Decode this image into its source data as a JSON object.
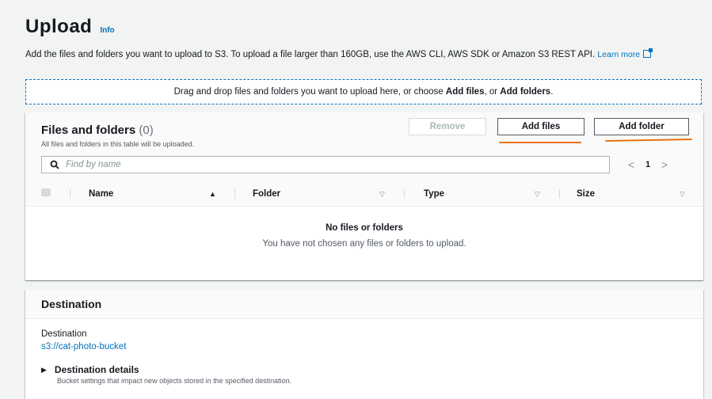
{
  "header": {
    "title": "Upload",
    "info": "Info"
  },
  "description": {
    "text": "Add the files and folders you want to upload to S3. To upload a file larger than 160GB, use the AWS CLI, AWS SDK or Amazon S3 REST API.",
    "learn_more": "Learn more"
  },
  "dropzone": {
    "prefix": "Drag and drop files and folders you want to upload here, or choose",
    "add_files": "Add files",
    "or": ", or",
    "add_folders": "Add folders",
    "suffix": "."
  },
  "files_panel": {
    "title": "Files and folders",
    "count": "(0)",
    "subtitle": "All files and folders in this table will be uploaded.",
    "remove_label": "Remove",
    "add_files_label": "Add files",
    "add_folder_label": "Add folder",
    "search_placeholder": "Find by name",
    "page": "1",
    "columns": [
      {
        "label": "Name",
        "sort": "▲"
      },
      {
        "label": "Folder",
        "sort": "▽"
      },
      {
        "label": "Type",
        "sort": "▽"
      },
      {
        "label": "Size",
        "sort": "▽"
      }
    ],
    "empty_title": "No files or folders",
    "empty_subtitle": "You have not chosen any files or folders to upload."
  },
  "destination": {
    "title": "Destination",
    "label": "Destination",
    "uri": "s3://cat-photo-bucket",
    "details_label": "Destination details",
    "details_sub": "Bucket settings that impact new objects stored in the specified destination."
  },
  "colors": {
    "link": "#0073bb",
    "annotation": "#ec7211",
    "border": "#545b64"
  },
  "icons": {
    "search": "search-icon",
    "external": "external-link-icon",
    "prev": "chevron-left-icon",
    "next": "chevron-right-icon",
    "caret": "caret-right-icon"
  }
}
